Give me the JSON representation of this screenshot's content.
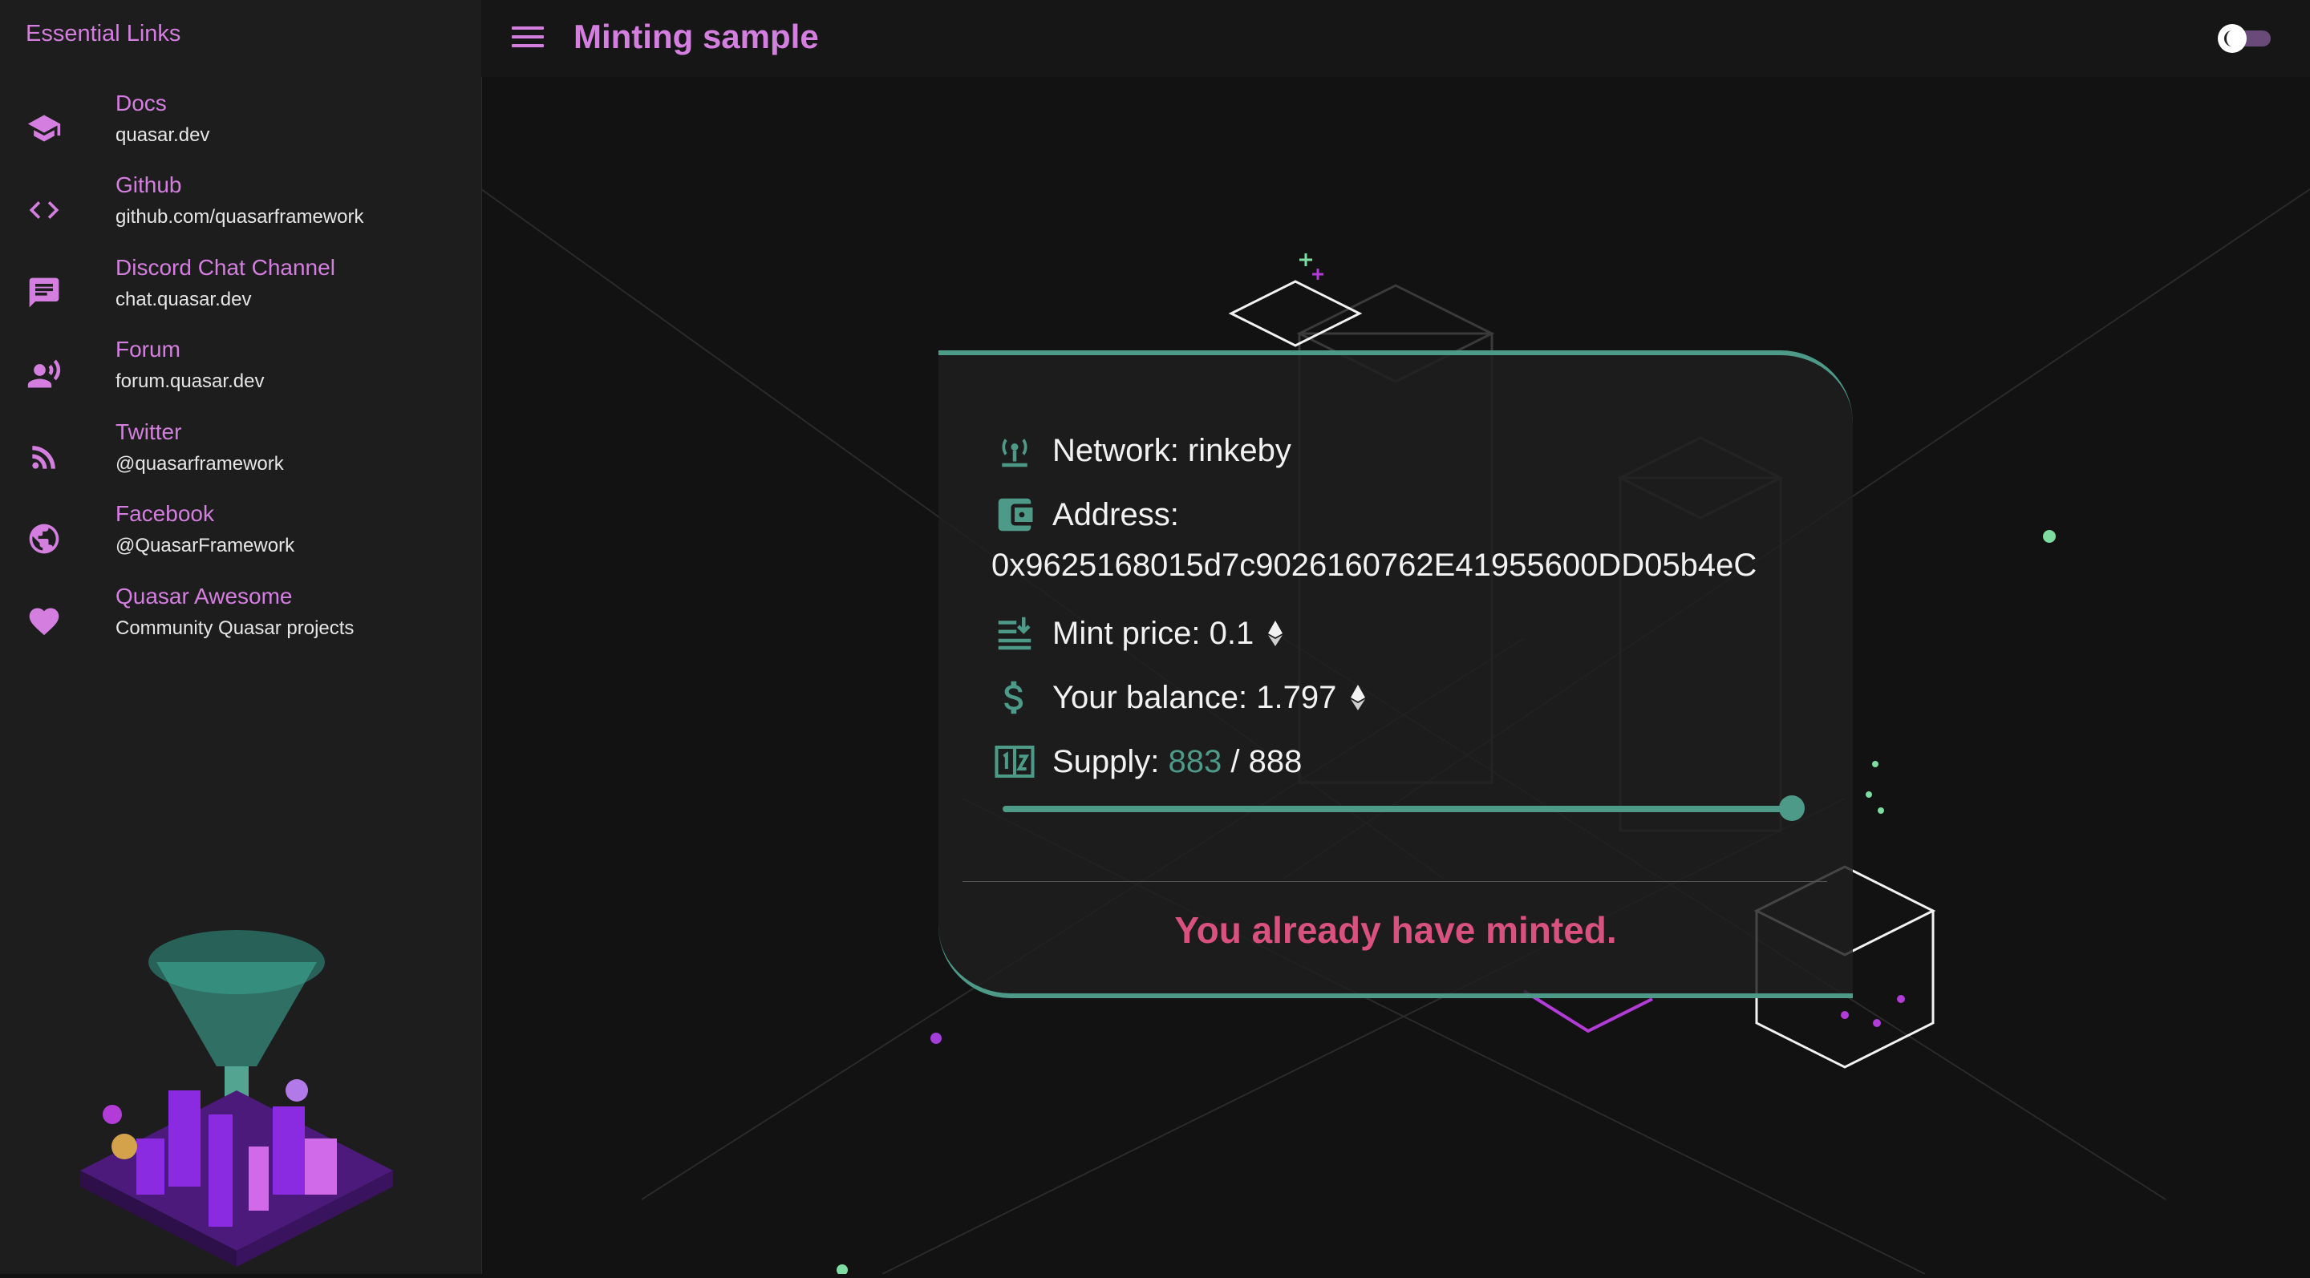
{
  "sidebar": {
    "header": "Essential Links",
    "items": [
      {
        "title": "Docs",
        "caption": "quasar.dev",
        "icon": "school-icon"
      },
      {
        "title": "Github",
        "caption": "github.com/quasarframework",
        "icon": "code-icon"
      },
      {
        "title": "Discord Chat Channel",
        "caption": "chat.quasar.dev",
        "icon": "chat-icon"
      },
      {
        "title": "Forum",
        "caption": "forum.quasar.dev",
        "icon": "record-voice-icon"
      },
      {
        "title": "Twitter",
        "caption": "@quasarframework",
        "icon": "rss-icon"
      },
      {
        "title": "Facebook",
        "caption": "@QuasarFramework",
        "icon": "public-icon"
      },
      {
        "title": "Quasar Awesome",
        "caption": "Community Quasar projects",
        "icon": "favorite-icon"
      }
    ]
  },
  "header": {
    "title": "Minting sample",
    "menu_icon": "menu-icon",
    "theme_toggle_icon": "dark-mode-toggle-icon"
  },
  "card": {
    "network_label": "Network: rinkeby",
    "address_label": "Address:",
    "address_value": "0x9625168015d7c9026160762E41955600DD05b4eC",
    "mint_price_label": "Mint price: 0.1",
    "balance_label": "Your balance: 1.797",
    "supply_label": "Supply:",
    "supply_minted": "883",
    "supply_separator": "/",
    "supply_total": "888",
    "supply_progress": 0.994,
    "status_message": "You already have minted."
  },
  "colors": {
    "accent": "#d47fe0",
    "teal": "#4d9a88",
    "status": "#d9517f",
    "background": "#121212",
    "sidebar": "#1d1d1d"
  }
}
